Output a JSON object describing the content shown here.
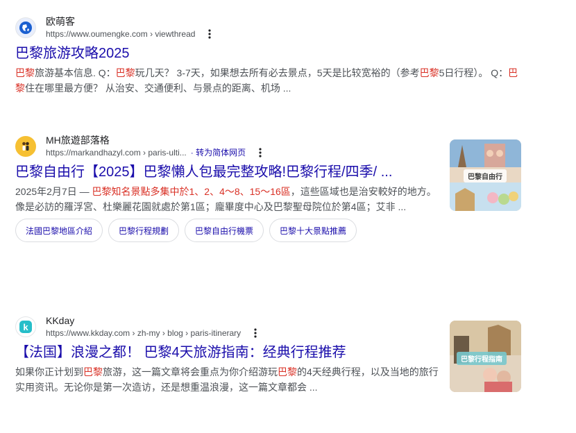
{
  "results": [
    {
      "site_name": "欧萌客",
      "url": "https://www.oumengke.com › viewthread",
      "title": "巴黎旅游攻略2025",
      "snippet_parts": [
        {
          "t": "巴黎",
          "h": true
        },
        {
          "t": "旅游基本信息. Q：",
          "h": false
        },
        {
          "t": "巴黎",
          "h": true
        },
        {
          "t": "玩几天？ 3-7天，如果想去所有必去景点，5天是比较宽裕的（参考",
          "h": false
        },
        {
          "t": "巴黎",
          "h": true
        },
        {
          "t": "5日行程）。 Q：",
          "h": false
        },
        {
          "t": "巴黎",
          "h": true
        },
        {
          "t": "住在哪里最方便？ 从治安、交通便利、与景点的距离、机场 ...",
          "h": false
        }
      ]
    },
    {
      "site_name": "MH旅遊部落格",
      "url": "https://markandhazyl.com › paris-ulti...",
      "translate": "· 转为简体网页",
      "title": "巴黎自由行【2025】巴黎懶人包最完整攻略!巴黎行程/四季/ ...",
      "thumb_text": "巴黎自由行",
      "snippet_parts": [
        {
          "t": "2025年2月7日 — ",
          "h": false
        },
        {
          "t": "巴黎知名景點多集中於1、2、4～8、15～16區",
          "h": true
        },
        {
          "t": "，這些區域也是治安較好的地方。像是必訪的羅浮宮、杜樂麗花園就處於第1區；龐畢度中心及巴黎聖母院位於第4區；艾非 ...",
          "h": false
        }
      ],
      "chips": [
        "法國巴黎地區介紹",
        "巴黎行程規劃",
        "巴黎自由行機票",
        "巴黎十大景點推薦"
      ]
    },
    {
      "site_name": "KKday",
      "url": "https://www.kkday.com › zh-my › blog › paris-itinerary",
      "title": "【法国】浪漫之都！ 巴黎4天旅游指南：经典行程推荐",
      "thumb_text": "巴黎行程指南",
      "snippet_parts": [
        {
          "t": "如果你正计划到",
          "h": false
        },
        {
          "t": "巴黎",
          "h": true
        },
        {
          "t": "旅游，这一篇文章将会重点为你介绍游玩",
          "h": false
        },
        {
          "t": "巴黎",
          "h": true
        },
        {
          "t": "的4天经典行程，以及当地的旅行实用资讯。无论你是第一次造访，还是想重温浪漫，这一篇文章都会 ...",
          "h": false
        }
      ]
    }
  ],
  "colors": {
    "link": "#1a0dab",
    "highlight": "#d93025",
    "snippet": "#4d5156"
  },
  "icons": [
    "globe-icon",
    "mh-avatar-icon",
    "kkday-logo-icon",
    "more-options-icon"
  ]
}
